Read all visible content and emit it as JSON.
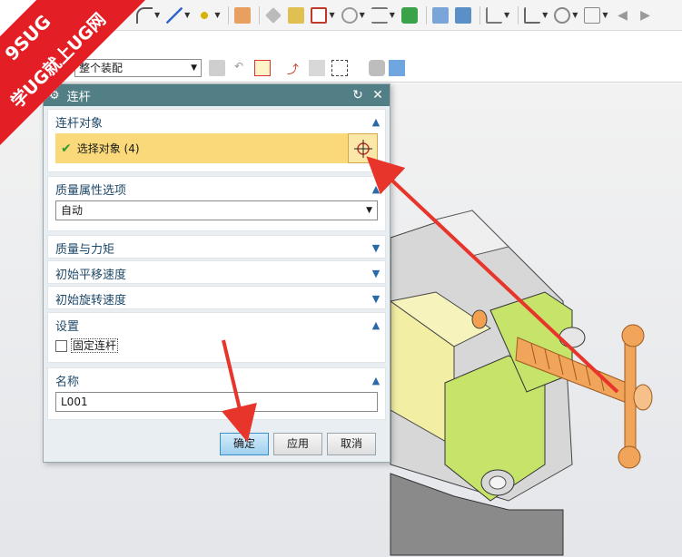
{
  "watermark": {
    "line1": "9SUG",
    "line2": "学UG就上UG网"
  },
  "toolbar2": {
    "assembly_select": "整个装配"
  },
  "dialog": {
    "title": "连杆",
    "sections": {
      "link_object": {
        "label": "连杆对象",
        "select_text": "选择对象 (4)"
      },
      "mass_props": {
        "label": "质量属性选项",
        "value": "自动"
      },
      "mass_moment": {
        "label": "质量与力矩"
      },
      "init_trans": {
        "label": "初始平移速度"
      },
      "init_rot": {
        "label": "初始旋转速度"
      },
      "settings": {
        "label": "设置",
        "fix_link": "固定连杆"
      },
      "name": {
        "label": "名称",
        "value": "L001"
      }
    },
    "buttons": {
      "ok": "确定",
      "apply": "应用",
      "cancel": "取消"
    }
  },
  "colors": {
    "title_bar": "#527f86",
    "selection": "#f9d97a",
    "accent": "#2a6aa8",
    "arrow": "#e8352b"
  }
}
